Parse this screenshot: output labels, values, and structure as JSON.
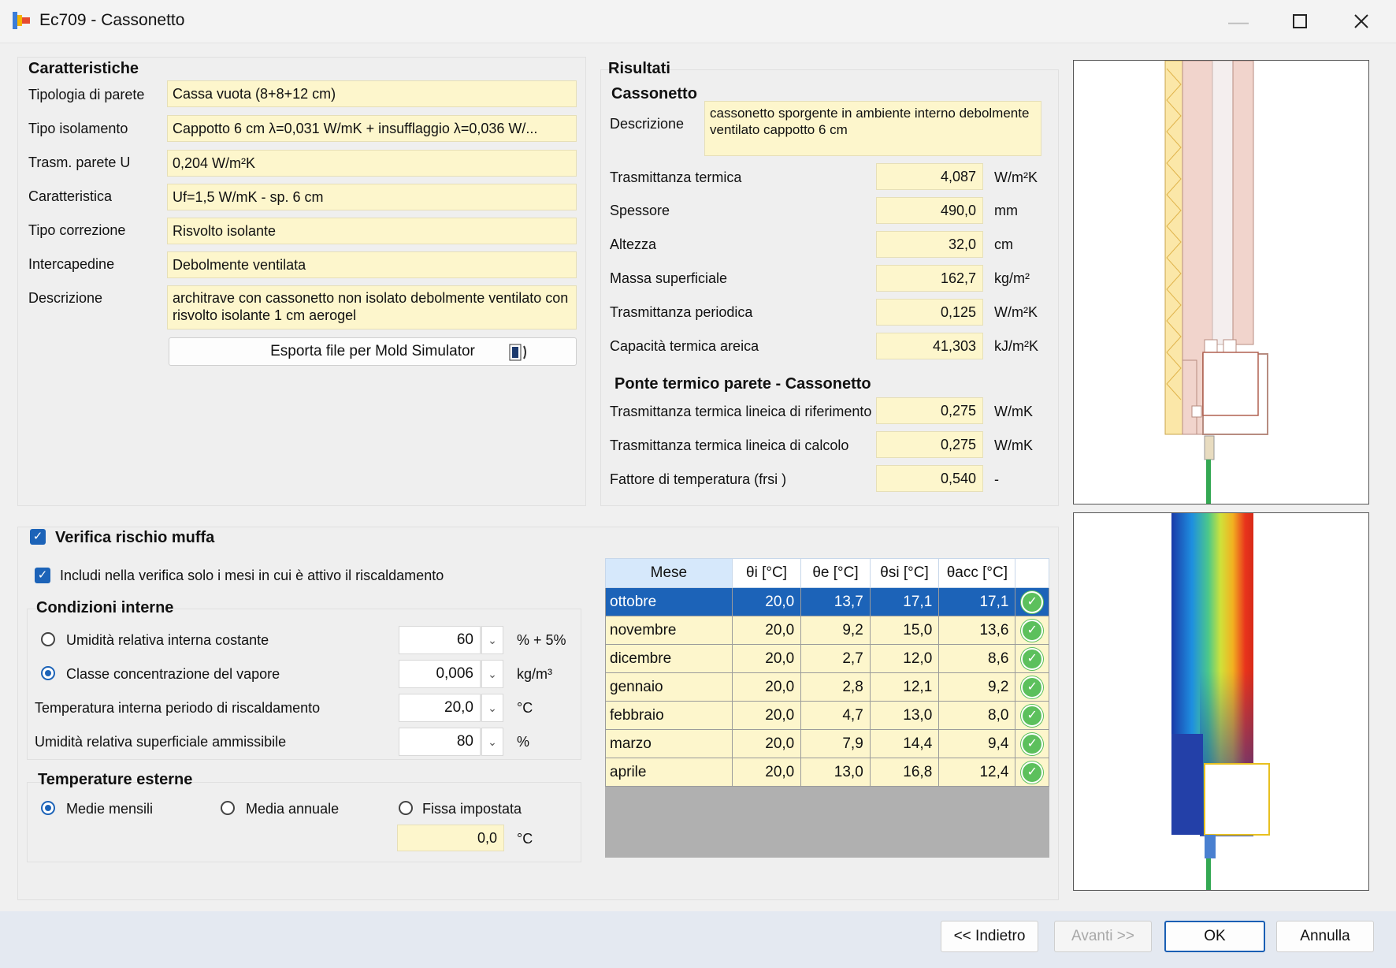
{
  "window": {
    "title": "Ec709 - Cassonetto"
  },
  "caratteristiche": {
    "heading": "Caratteristiche",
    "rows": [
      {
        "label": "Tipologia di parete",
        "value": "Cassa vuota (8+8+12 cm)"
      },
      {
        "label": "Tipo isolamento",
        "value": "Cappotto 6 cm  λ=0,031 W/mK + insufflaggio λ=0,036 W/..."
      },
      {
        "label": "Trasm. parete U",
        "value": "0,204 W/m²K"
      },
      {
        "label": "Caratteristica",
        "value": "Uf=1,5 W/mK - sp. 6 cm"
      },
      {
        "label": "Tipo correzione",
        "value": "Risvolto isolante"
      },
      {
        "label": "Intercapedine",
        "value": "Debolmente ventilata"
      }
    ],
    "descrizione_label": "Descrizione",
    "descrizione_value": "architrave con cassonetto non isolato debolmente ventilato con risvolto isolante 1 cm aerogel",
    "export_button": "Esporta file per Mold Simulator"
  },
  "risultati": {
    "heading": "Risultati",
    "cassonetto_heading": "Cassonetto",
    "descrizione_label": "Descrizione",
    "descrizione_value": "cassonetto sporgente in ambiente interno debolmente ventilato cappotto 6 cm",
    "rows": [
      {
        "label": "Trasmittanza termica",
        "value": "4,087",
        "unit": "W/m²K"
      },
      {
        "label": "Spessore",
        "value": "490,0",
        "unit": "mm"
      },
      {
        "label": "Altezza",
        "value": "32,0",
        "unit": "cm"
      },
      {
        "label": "Massa superficiale",
        "value": "162,7",
        "unit": "kg/m²"
      },
      {
        "label": "Trasmittanza periodica",
        "value": "0,125",
        "unit": "W/m²K"
      },
      {
        "label": "Capacità termica areica",
        "value": "41,303",
        "unit": "kJ/m²K"
      }
    ],
    "ponte_heading": "Ponte termico parete - Cassonetto",
    "ponte_rows": [
      {
        "label": "Trasmittanza termica lineica di riferimento",
        "value": "0,275",
        "unit": "W/mK"
      },
      {
        "label": "Trasmittanza termica lineica di calcolo",
        "value": "0,275",
        "unit": "W/mK"
      },
      {
        "label": "Fattore di temperatura  (frsi )",
        "value": "0,540",
        "unit": "-"
      }
    ]
  },
  "muffa": {
    "checkbox_label": "Verifica rischio muffa",
    "includi_label": "Includi nella verifica solo i mesi in cui è attivo il riscaldamento",
    "cond_heading": "Condizioni interne",
    "umidita_costante_label": "Umidità relativa interna costante",
    "umidita_costante_value": "60",
    "umidita_costante_unit": "% + 5%",
    "classe_label": "Classe concentrazione del vapore",
    "classe_value": "0,006",
    "classe_unit": "kg/m³",
    "temp_int_label": "Temperatura interna periodo di riscaldamento",
    "temp_int_value": "20,0",
    "temp_int_unit": "°C",
    "umid_sup_label": "Umidità relativa superficiale ammissibile",
    "umid_sup_value": "80",
    "umid_sup_unit": "%",
    "temp_est_heading": "Temperature esterne",
    "medie_label": "Medie mensili",
    "media_annuale_label": "Media annuale",
    "fissa_label": "Fissa impostata",
    "fissa_value": "0,0",
    "fissa_unit": "°C"
  },
  "table": {
    "headers": [
      "Mese",
      "θi [°C]",
      "θe [°C]",
      "θsi [°C]",
      "θacc [°C]"
    ],
    "rows": [
      [
        "ottobre",
        "20,0",
        "13,7",
        "17,1",
        "17,1"
      ],
      [
        "novembre",
        "20,0",
        "9,2",
        "15,0",
        "13,6"
      ],
      [
        "dicembre",
        "20,0",
        "2,7",
        "12,0",
        "8,6"
      ],
      [
        "gennaio",
        "20,0",
        "2,8",
        "12,1",
        "9,2"
      ],
      [
        "febbraio",
        "20,0",
        "4,7",
        "13,0",
        "8,0"
      ],
      [
        "marzo",
        "20,0",
        "7,9",
        "14,4",
        "9,4"
      ],
      [
        "aprile",
        "20,0",
        "13,0",
        "16,8",
        "12,4"
      ]
    ]
  },
  "footer": {
    "back": "<< Indietro",
    "next": "Avanti >>",
    "ok": "OK",
    "cancel": "Annulla"
  },
  "colors": {
    "accent": "#1c63b8",
    "field_bg": "#fdf6cc",
    "ok_green": "#5cc05c"
  }
}
